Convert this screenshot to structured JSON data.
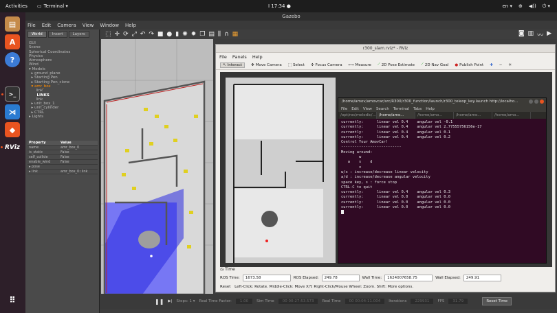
{
  "topbar": {
    "activities": "Activities",
    "app": "Terminal ▾",
    "clock": "Ⅰ 17:34 ●",
    "tray": [
      "en ▾",
      "⊕",
      "◀))",
      "⏻ ▾"
    ]
  },
  "gazebo": {
    "title": "Gazebo",
    "menu": [
      "File",
      "Edit",
      "Camera",
      "View",
      "Window",
      "Help"
    ],
    "tabs": [
      "World",
      "Insert",
      "Layers"
    ],
    "tree": [
      "GUI",
      "Scene",
      "Spherical Coordinates",
      "Physics",
      "Atmosphere",
      "Wind",
      "▾ Models",
      "  ▸ ground_plane",
      "  ▸ Starting Pen",
      "  ▸ Starting Pen_clone",
      "  ▾ amr_box",
      "      link",
      "      LINKS",
      "      link",
      "  ▸ unit_box_1",
      "  ▸ unit_cylinder",
      "  ▸ CTRL",
      "▸ Lights"
    ],
    "props_header": [
      "Property",
      "Value"
    ],
    "props": [
      [
        "name",
        "amr_box_0"
      ],
      [
        "is_static",
        "False"
      ],
      [
        "self_collide",
        "False"
      ],
      [
        "enable_wind",
        "False"
      ],
      [
        "▸ pose",
        ""
      ],
      [
        "▸ link",
        "amr_box_0::link"
      ]
    ],
    "bottom": {
      "steps": "Steps: 1 ▾",
      "rtf_label": "Real Time Factor:",
      "rtf": "1.00",
      "sim_label": "Sim Time",
      "sim": "00 00:27:53.573",
      "real_label": "Real Time",
      "real": "00 00:04:11.004",
      "iter_label": "Iterations",
      "iter": "229931",
      "fps_label": "FPS",
      "fps": "31.79",
      "reset": "Reset Time"
    }
  },
  "rviz": {
    "title": "r300_slam.rviz* - RViz",
    "menu": [
      "File",
      "Panels",
      "Help"
    ],
    "tools": [
      "Interact",
      "Move Camera",
      "Select",
      "Focus Camera",
      "Measure",
      "2D Pose Estimate",
      "2D Nav Goal",
      "Publish Point"
    ],
    "time_title": "Time",
    "ros_time_label": "ROS Time:",
    "ros_time": "1673.58",
    "ros_elapsed_label": "ROS Elapsed:",
    "ros_elapsed": "249.78",
    "wall_time_label": "Wall Time:",
    "wall_time": "1624007658.75",
    "wall_elapsed_label": "Wall Elapsed:",
    "wall_elapsed": "249.91",
    "reset": "Reset",
    "status": "Left-Click: Rotate. Middle-Click: Move X/Y. Right-Click/Mouse Wheel: Zoom. Shift: More options."
  },
  "terminal": {
    "title": "/home/amov/amovcar/src/R300/r300_function/launch/r300_teleop_key.launch http://localho...",
    "menu": [
      "File",
      "Edit",
      "View",
      "Search",
      "Terminal",
      "Tabs",
      "Help"
    ],
    "tabs": [
      "/opt/ros/melodic/...",
      "/home/amo...",
      "/home/amo...",
      "/home/amo...",
      "/home/amo..."
    ],
    "lines": [
      "currently:      linear vel 0.4    angular vel -0.1",
      "currently:      linear vel 0.4    angular vel 2.77555756156e-17",
      "currently:      linear vel 0.4    angular vel 0.1",
      "currently:      linear vel 0.4    angular vel 0.2",
      "",
      "Control Your AmovCar!",
      "---------------------------",
      "Moving around:",
      "        w",
      "   a    s    d",
      "        x",
      "",
      "w/x : increase/decrease linear velocity",
      "a/d : increase/decrease angular velocity",
      "",
      "space key, s : force stop",
      "",
      "CTRL-C to quit",
      "",
      "currently:      linear vel 0.4    angular vel 0.3",
      "currently:      linear vel 0.0    angular vel 0.0",
      "currently:      linear vel 0.0    angular vel 0.0",
      "currently:      linear vel 0.0    angular vel 0.0"
    ]
  },
  "dock": [
    "files-icon",
    "software-icon",
    "help-icon",
    "terminal-icon",
    "vscode-icon",
    "layers-icon",
    "rviz-icon",
    "apps-grid-icon"
  ],
  "colors": {
    "ubuntu_orange": "#e95420",
    "terminal_bg": "#300a24",
    "laser_blue": "#3b3bff"
  }
}
